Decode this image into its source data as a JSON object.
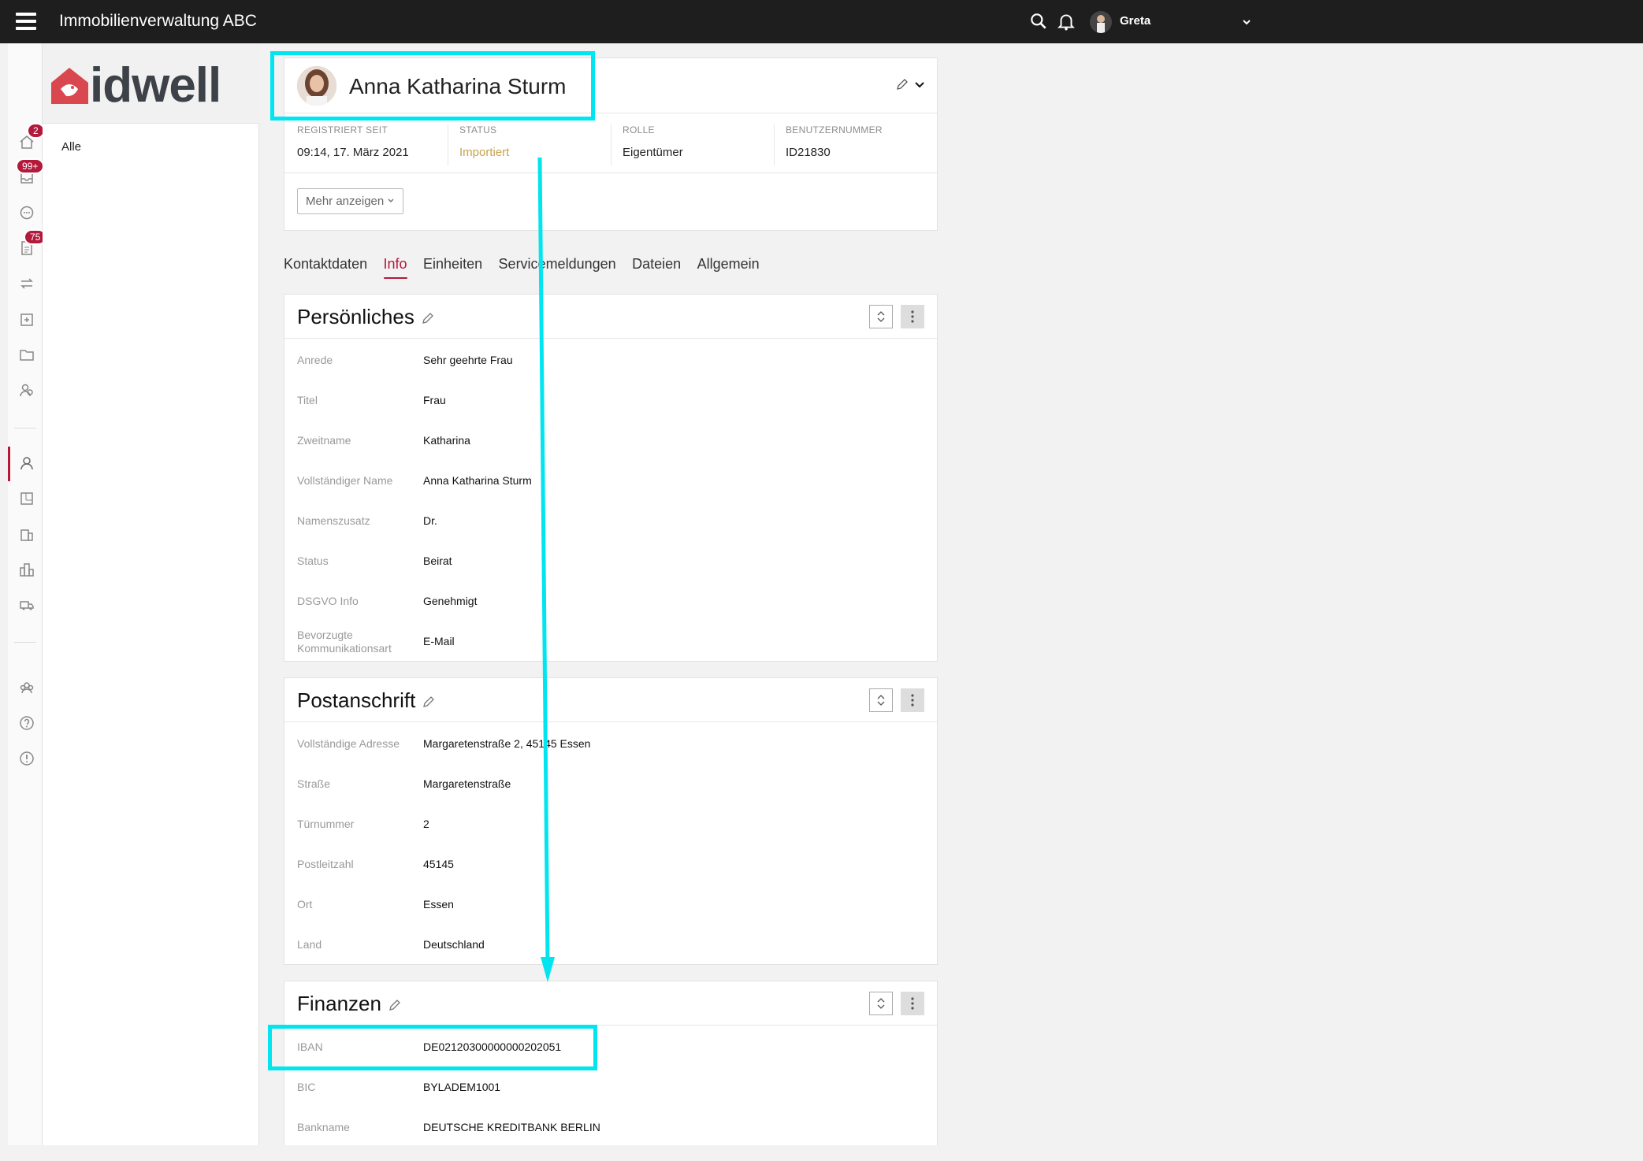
{
  "app": {
    "title": "Immobilienverwaltung ABC",
    "user": "Greta"
  },
  "sidebar": {
    "logo": "idwell",
    "filter": "Alle",
    "badges": {
      "home": "2",
      "inbox": "99+",
      "docs": "75"
    }
  },
  "profile": {
    "name": "Anna Katharina Sturm",
    "meta": [
      {
        "label": "REGISTRIERT SEIT",
        "value": "09:14, 17. März 2021"
      },
      {
        "label": "STATUS",
        "value": "Importiert"
      },
      {
        "label": "ROLLE",
        "value": "Eigentümer"
      },
      {
        "label": "BENUTZERNUMMER",
        "value": "ID21830"
      }
    ],
    "more_button": "Mehr anzeigen"
  },
  "tabs": [
    "Kontaktdaten",
    "Info",
    "Einheiten",
    "Servicemeldungen",
    "Dateien",
    "Allgemein"
  ],
  "sections": {
    "personal": {
      "title": "Persönliches",
      "rows": [
        {
          "k": "Anrede",
          "v": "Sehr geehrte Frau"
        },
        {
          "k": "Titel",
          "v": "Frau"
        },
        {
          "k": "Zweitname",
          "v": "Katharina"
        },
        {
          "k": "Vollständiger Name",
          "v": "Anna Katharina Sturm"
        },
        {
          "k": "Namenszusatz",
          "v": "Dr."
        },
        {
          "k": "Status",
          "v": "Beirat"
        },
        {
          "k": "DSGVO Info",
          "v": "Genehmigt"
        },
        {
          "k": "Bevorzugte Kommunikationsart",
          "v": "E-Mail"
        }
      ]
    },
    "address": {
      "title": "Postanschrift",
      "rows": [
        {
          "k": "Vollständige Adresse",
          "v": "Margaretenstraße 2, 45145 Essen"
        },
        {
          "k": "Straße",
          "v": "Margaretenstraße"
        },
        {
          "k": "Türnummer",
          "v": "2"
        },
        {
          "k": "Postleitzahl",
          "v": "45145"
        },
        {
          "k": "Ort",
          "v": "Essen"
        },
        {
          "k": "Land",
          "v": "Deutschland"
        }
      ]
    },
    "finance": {
      "title": "Finanzen",
      "rows": [
        {
          "k": "IBAN",
          "v": "DE02120300000000202051"
        },
        {
          "k": "BIC",
          "v": "BYLADEM1001"
        },
        {
          "k": "Bankname",
          "v": "DEUTSCHE KREDITBANK BERLIN"
        }
      ]
    }
  }
}
